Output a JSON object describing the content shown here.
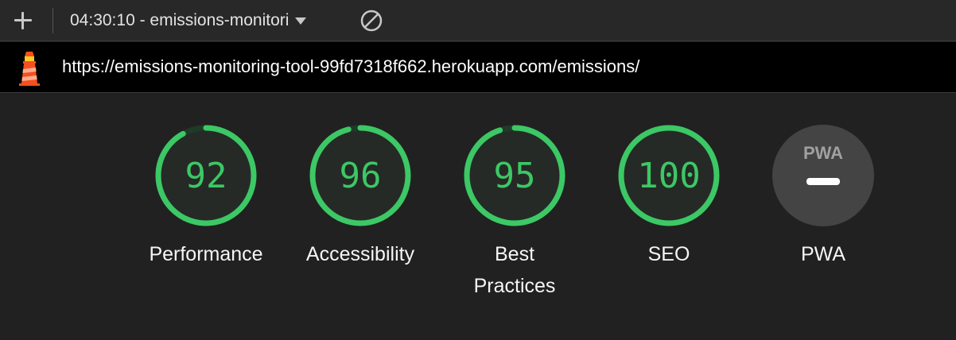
{
  "toolbar": {
    "report_title": "04:30:10 - emissions-monitori",
    "add_icon": "plus-icon",
    "dropdown_icon": "caret-down-icon",
    "clear_icon": "block-icon"
  },
  "urlbar": {
    "logo": "lighthouse-logo",
    "url": "https://emissions-monitoring-tool-99fd7318f662.herokuapp.com/emissions/"
  },
  "colors": {
    "pass": "#3cc865",
    "gauge_track": "#1e3b27",
    "gauge_bg": "#262a26",
    "pwa_bg": "#444444"
  },
  "categories": [
    {
      "label_line1": "Performance",
      "label_line2": "",
      "score": "92",
      "fraction": 0.92
    },
    {
      "label_line1": "Accessibility",
      "label_line2": "",
      "score": "96",
      "fraction": 0.96
    },
    {
      "label_line1": "Best",
      "label_line2": "Practices",
      "score": "95",
      "fraction": 0.95
    },
    {
      "label_line1": "SEO",
      "label_line2": "",
      "score": "100",
      "fraction": 1.0
    }
  ],
  "pwa": {
    "badge_text": "PWA",
    "label": "PWA"
  }
}
